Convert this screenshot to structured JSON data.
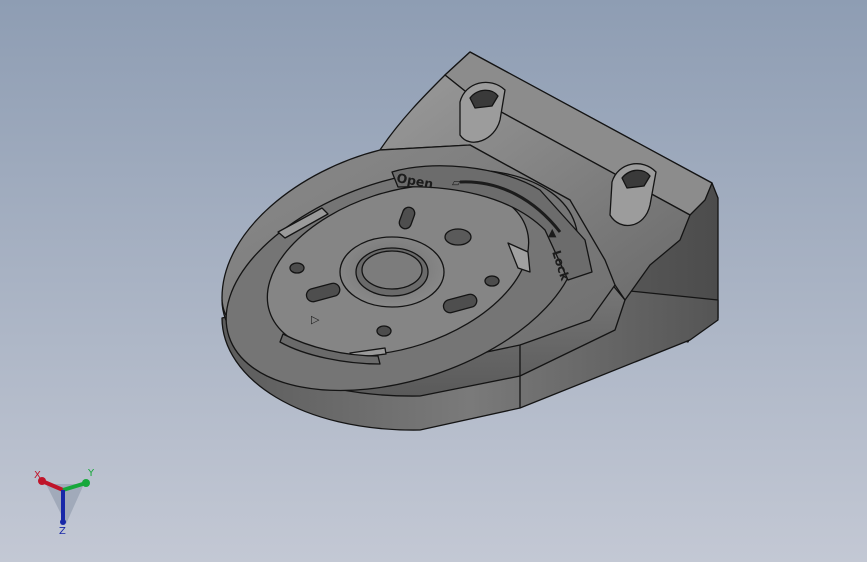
{
  "colors": {
    "bg_top": "#8e9db3",
    "bg_bottom": "#c3c8d4",
    "part_light": "#8a8a8a",
    "part_mid": "#6e6e6e",
    "part_dark": "#4e4e4e",
    "edge": "#141414",
    "axis_x": "#c0142a",
    "axis_y": "#16a83a",
    "axis_z": "#1828a8"
  },
  "model": {
    "label_open": "Open",
    "label_lock": "Lock"
  },
  "triad": {
    "x_label": "X",
    "y_label": "Y",
    "z_label": "Z"
  }
}
